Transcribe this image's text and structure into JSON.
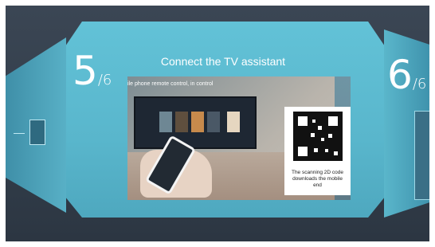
{
  "title": "Connect the TV assistant",
  "current_step": {
    "number": "5",
    "total": "/6"
  },
  "next_step": {
    "number": "6",
    "total": "/6"
  },
  "caption_top": "ile phone remote control, in control",
  "qr_caption": "The scanning 2D code downloads the mobile end",
  "colors": {
    "panel": "#5ab6cb",
    "background": "#34404d",
    "text": "#ffffff"
  },
  "icons": [
    "qr-code-icon"
  ]
}
